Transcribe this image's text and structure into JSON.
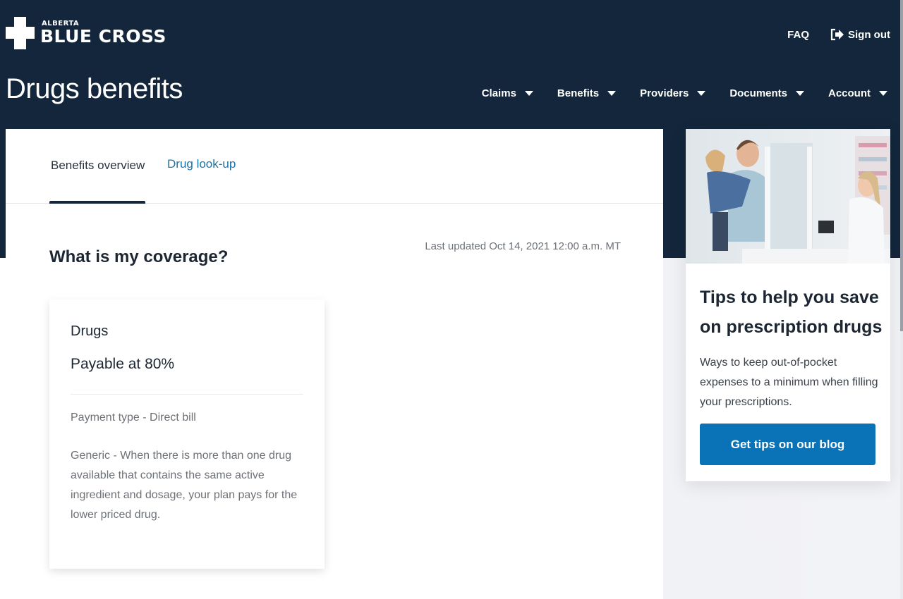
{
  "brand": {
    "small": "ALBERTA",
    "big": "BLUE CROSS"
  },
  "utility": {
    "faq": "FAQ",
    "sign_out": "Sign out"
  },
  "page_title": "Drugs benefits",
  "nav": {
    "items": [
      {
        "label": "Claims"
      },
      {
        "label": "Benefits"
      },
      {
        "label": "Providers"
      },
      {
        "label": "Documents"
      },
      {
        "label": "Account"
      }
    ]
  },
  "tabs": [
    {
      "label": "Benefits overview",
      "active": true
    },
    {
      "label": "Drug look-up",
      "active": false
    }
  ],
  "coverage": {
    "title": "What is my coverage?",
    "last_updated": "Last updated Oct 14, 2021 12:00 a.m. MT",
    "card": {
      "title": "Drugs",
      "payable": "Payable at 80%",
      "payment_type": "Payment type - Direct bill",
      "generic": "Generic - When there is more than one drug available that contains the same active ingredient and dosage, your plan pays for the lower priced drug."
    }
  },
  "promo": {
    "image_alt": "Father holding child at pharmacy counter talking with pharmacist",
    "title": "Tips to help you save on prescription drugs",
    "text": "Ways to keep out-of-pocket expenses to a minimum when filling your prescriptions.",
    "button": "Get tips on our blog"
  },
  "colors": {
    "header": "#13263b",
    "link": "#1a73a8",
    "button": "#0a72b6"
  }
}
